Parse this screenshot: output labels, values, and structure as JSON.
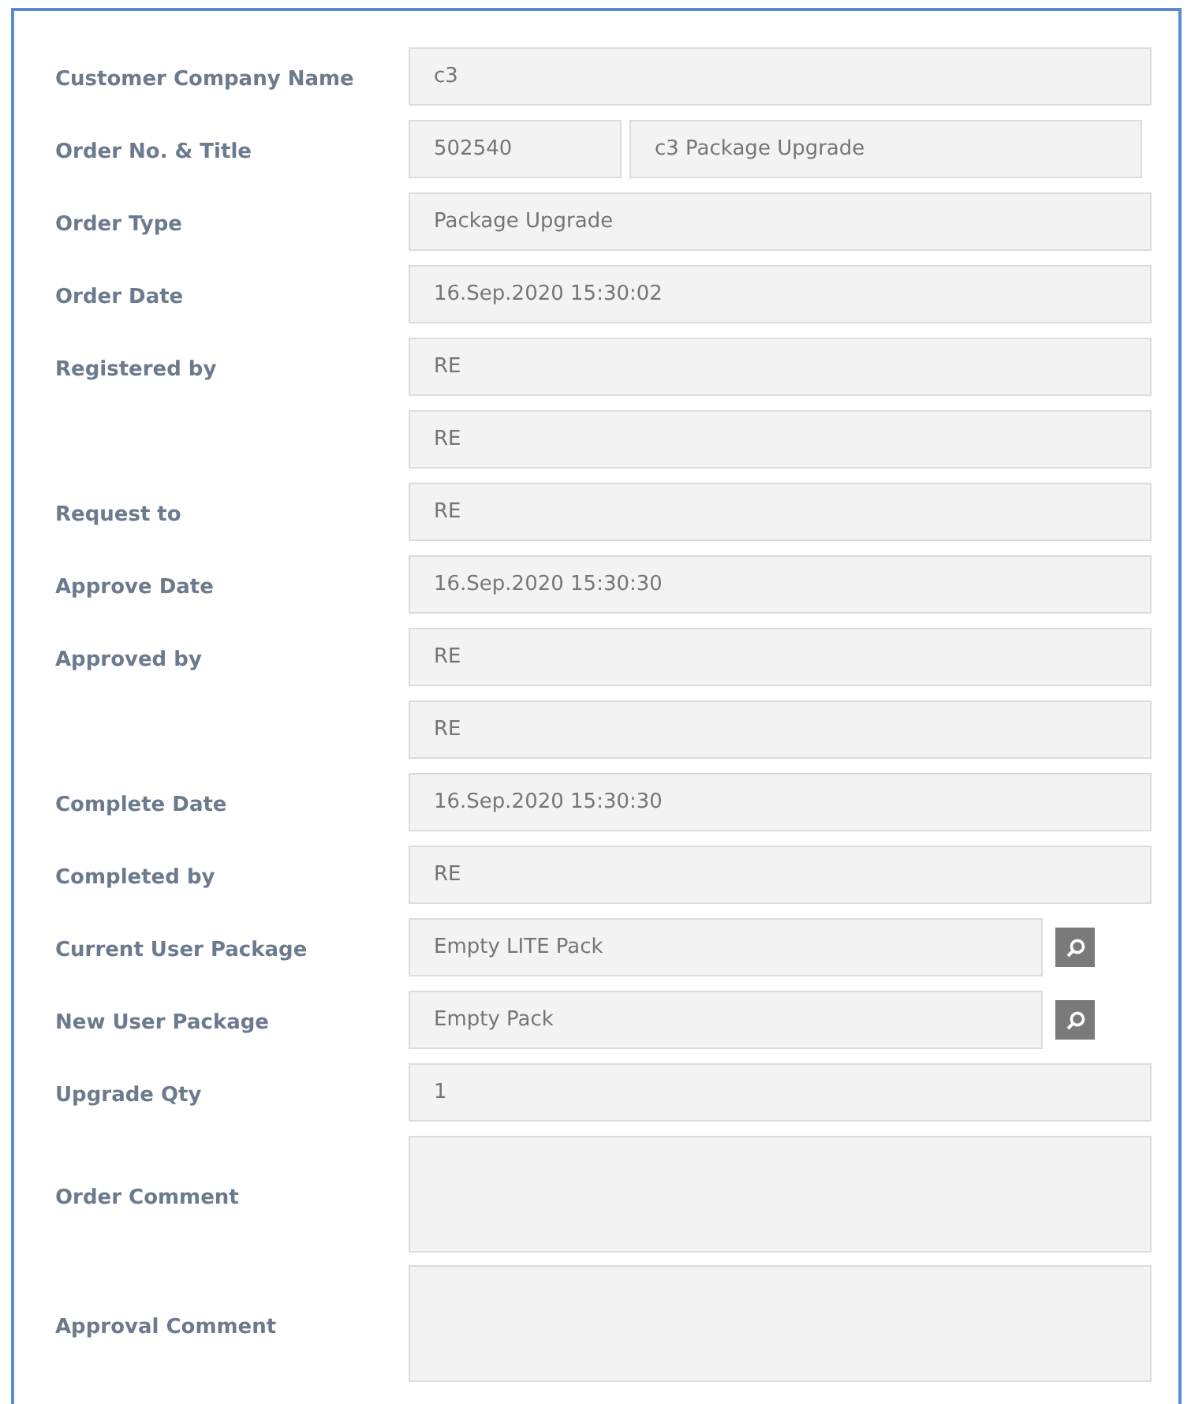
{
  "fields": [
    {
      "kind": "text",
      "label": "Customer Company Name",
      "value": "c3"
    },
    {
      "kind": "pair",
      "label": "Order No. & Title",
      "values": [
        "502540",
        "c3 Package Upgrade"
      ]
    },
    {
      "kind": "text",
      "label": "Order Type",
      "value": "Package Upgrade"
    },
    {
      "kind": "text",
      "label": "Order Date",
      "value": "16.Sep.2020 15:30:02"
    },
    {
      "kind": "text",
      "label": "Registered by",
      "value": "RE"
    },
    {
      "kind": "text",
      "value": "RE"
    },
    {
      "kind": "text",
      "label": "Request to",
      "value": "RE"
    },
    {
      "kind": "text",
      "label": "Approve Date",
      "value": "16.Sep.2020 15:30:30"
    },
    {
      "kind": "text",
      "label": "Approved by",
      "value": "RE"
    },
    {
      "kind": "text",
      "value": "RE"
    },
    {
      "kind": "text",
      "label": "Complete Date",
      "value": "16.Sep.2020 15:30:30"
    },
    {
      "kind": "text",
      "label": "Completed by",
      "value": "RE"
    },
    {
      "kind": "lookup",
      "label": "Current User Package",
      "value": "Empty LITE Pack"
    },
    {
      "kind": "lookup",
      "label": "New User Package",
      "value": "Empty Pack"
    },
    {
      "kind": "text",
      "label": "Upgrade Qty",
      "value": "1"
    },
    {
      "kind": "textarea",
      "label": "Order Comment"
    },
    {
      "kind": "textarea",
      "label": "Approval Comment"
    }
  ]
}
